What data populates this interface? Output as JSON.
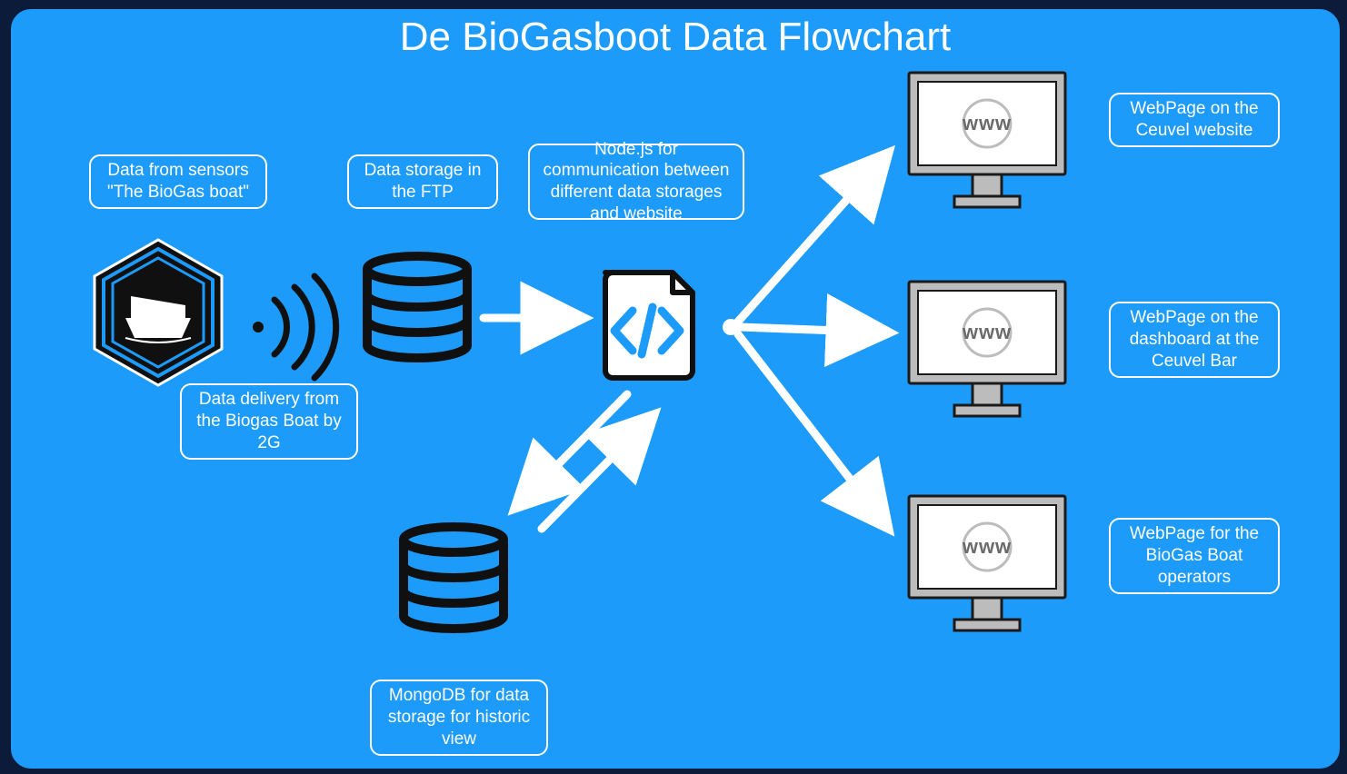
{
  "title": "De BioGasboot Data Flowchart",
  "labels": {
    "sensors": "Data from sensors \"The BioGas boat\"",
    "delivery": "Data delivery from the Biogas Boat by 2G",
    "ftp": "Data storage in the FTP",
    "node": "Node.js for communication between different data storages and website",
    "mongo": "MongoDB for data storage for historic view",
    "web1": "WebPage on the Ceuvel website",
    "web2": "WebPage on the dashboard at the Ceuvel Bar",
    "web3": "WebPage for the BioGas Boat operators"
  },
  "www": "www"
}
